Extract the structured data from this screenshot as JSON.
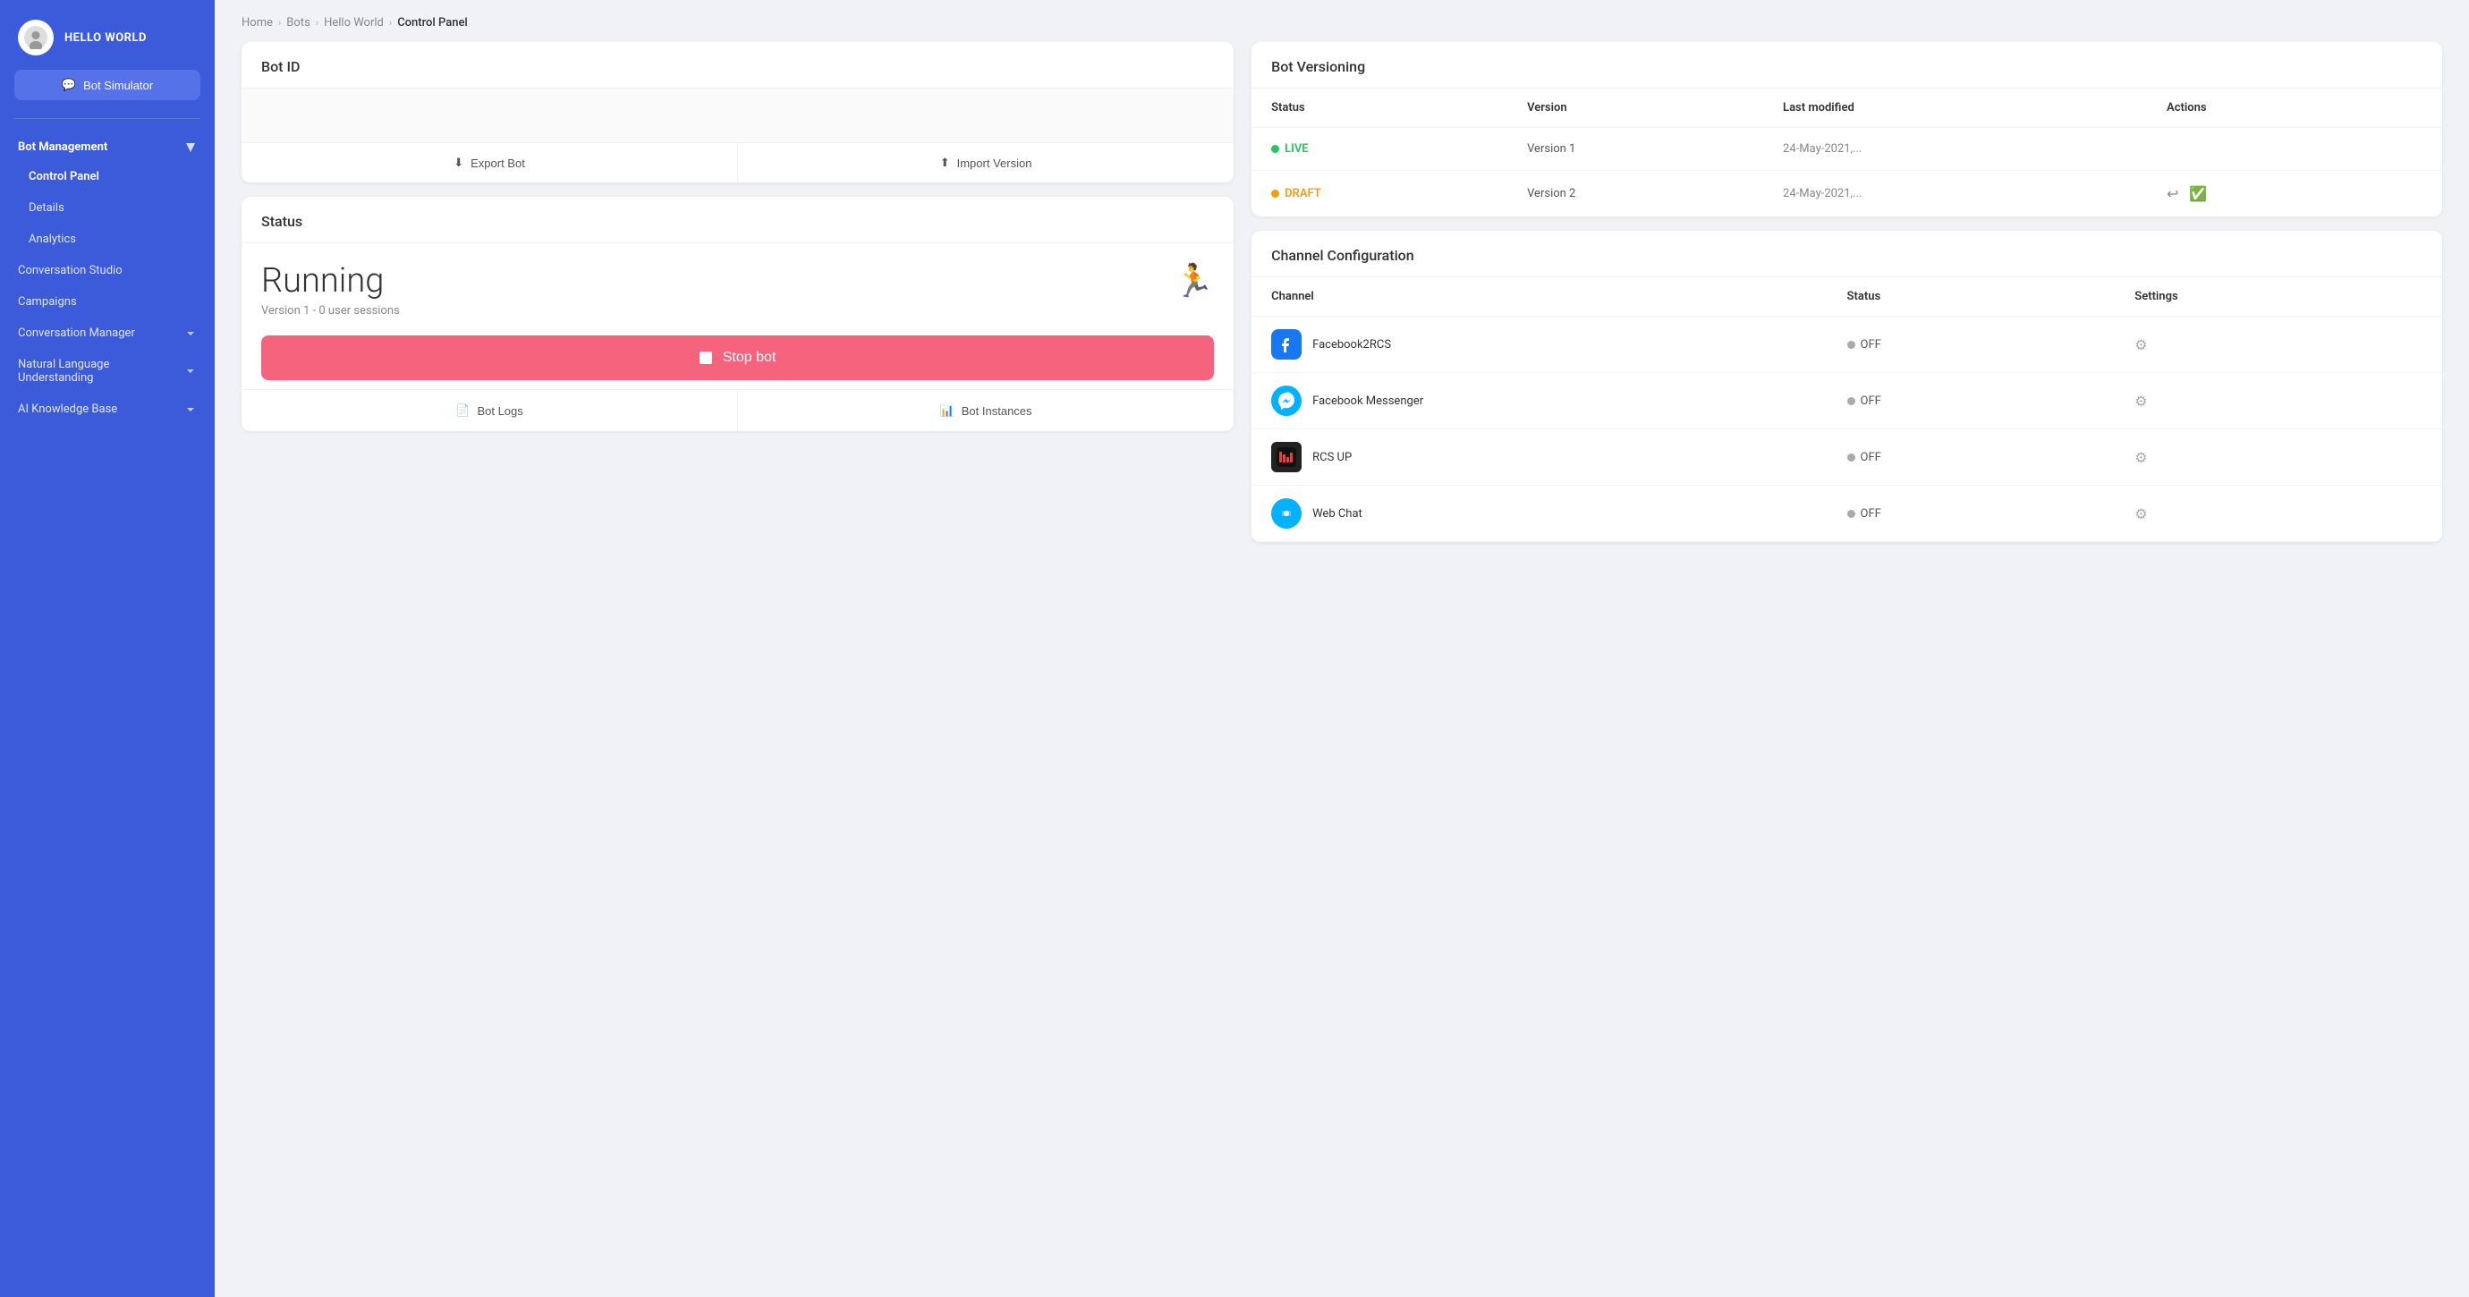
{
  "sidebar": {
    "bot_name": "HELLO WORLD",
    "bot_simulator_label": "Bot Simulator",
    "bot_management_label": "Bot Management",
    "nav_items": [
      {
        "id": "control-panel",
        "label": "Control Panel",
        "active": true
      },
      {
        "id": "details",
        "label": "Details",
        "active": false
      },
      {
        "id": "analytics",
        "label": "Analytics",
        "active": false
      }
    ],
    "conversation_studio_label": "Conversation Studio",
    "campaigns_label": "Campaigns",
    "conversation_manager_label": "Conversation Manager",
    "nlu_label": "Natural Language Understanding",
    "ai_knowledge_label": "AI Knowledge Base"
  },
  "breadcrumb": {
    "home": "Home",
    "bots": "Bots",
    "hello_world": "Hello World",
    "current": "Control Panel"
  },
  "bot_id_card": {
    "title": "Bot ID",
    "export_label": "Export Bot",
    "import_label": "Import Version"
  },
  "status_card": {
    "title": "Status",
    "running_text": "Running",
    "version_sessions": "Version 1 - 0 user sessions",
    "stop_button_label": "Stop bot",
    "bot_logs_label": "Bot Logs",
    "bot_instances_label": "Bot Instances"
  },
  "versioning_card": {
    "title": "Bot Versioning",
    "columns": [
      "Status",
      "Version",
      "Last modified",
      "Actions"
    ],
    "rows": [
      {
        "status": "LIVE",
        "status_type": "live",
        "version": "Version 1",
        "last_modified": "24-May-2021,...",
        "actions": []
      },
      {
        "status": "DRAFT",
        "status_type": "draft",
        "version": "Version 2",
        "last_modified": "24-May-2021,...",
        "actions": [
          "restore",
          "approve"
        ]
      }
    ]
  },
  "channel_config_card": {
    "title": "Channel Configuration",
    "columns": [
      "Channel",
      "Status",
      "Settings"
    ],
    "rows": [
      {
        "name": "Facebook2RCS",
        "icon_type": "facebook2rcs",
        "status": "OFF"
      },
      {
        "name": "Facebook Messenger",
        "icon_type": "facebook-messenger",
        "status": "OFF"
      },
      {
        "name": "RCS UP",
        "icon_type": "rcs-up",
        "status": "OFF"
      },
      {
        "name": "Web Chat",
        "icon_type": "web-chat",
        "status": "OFF"
      }
    ]
  }
}
